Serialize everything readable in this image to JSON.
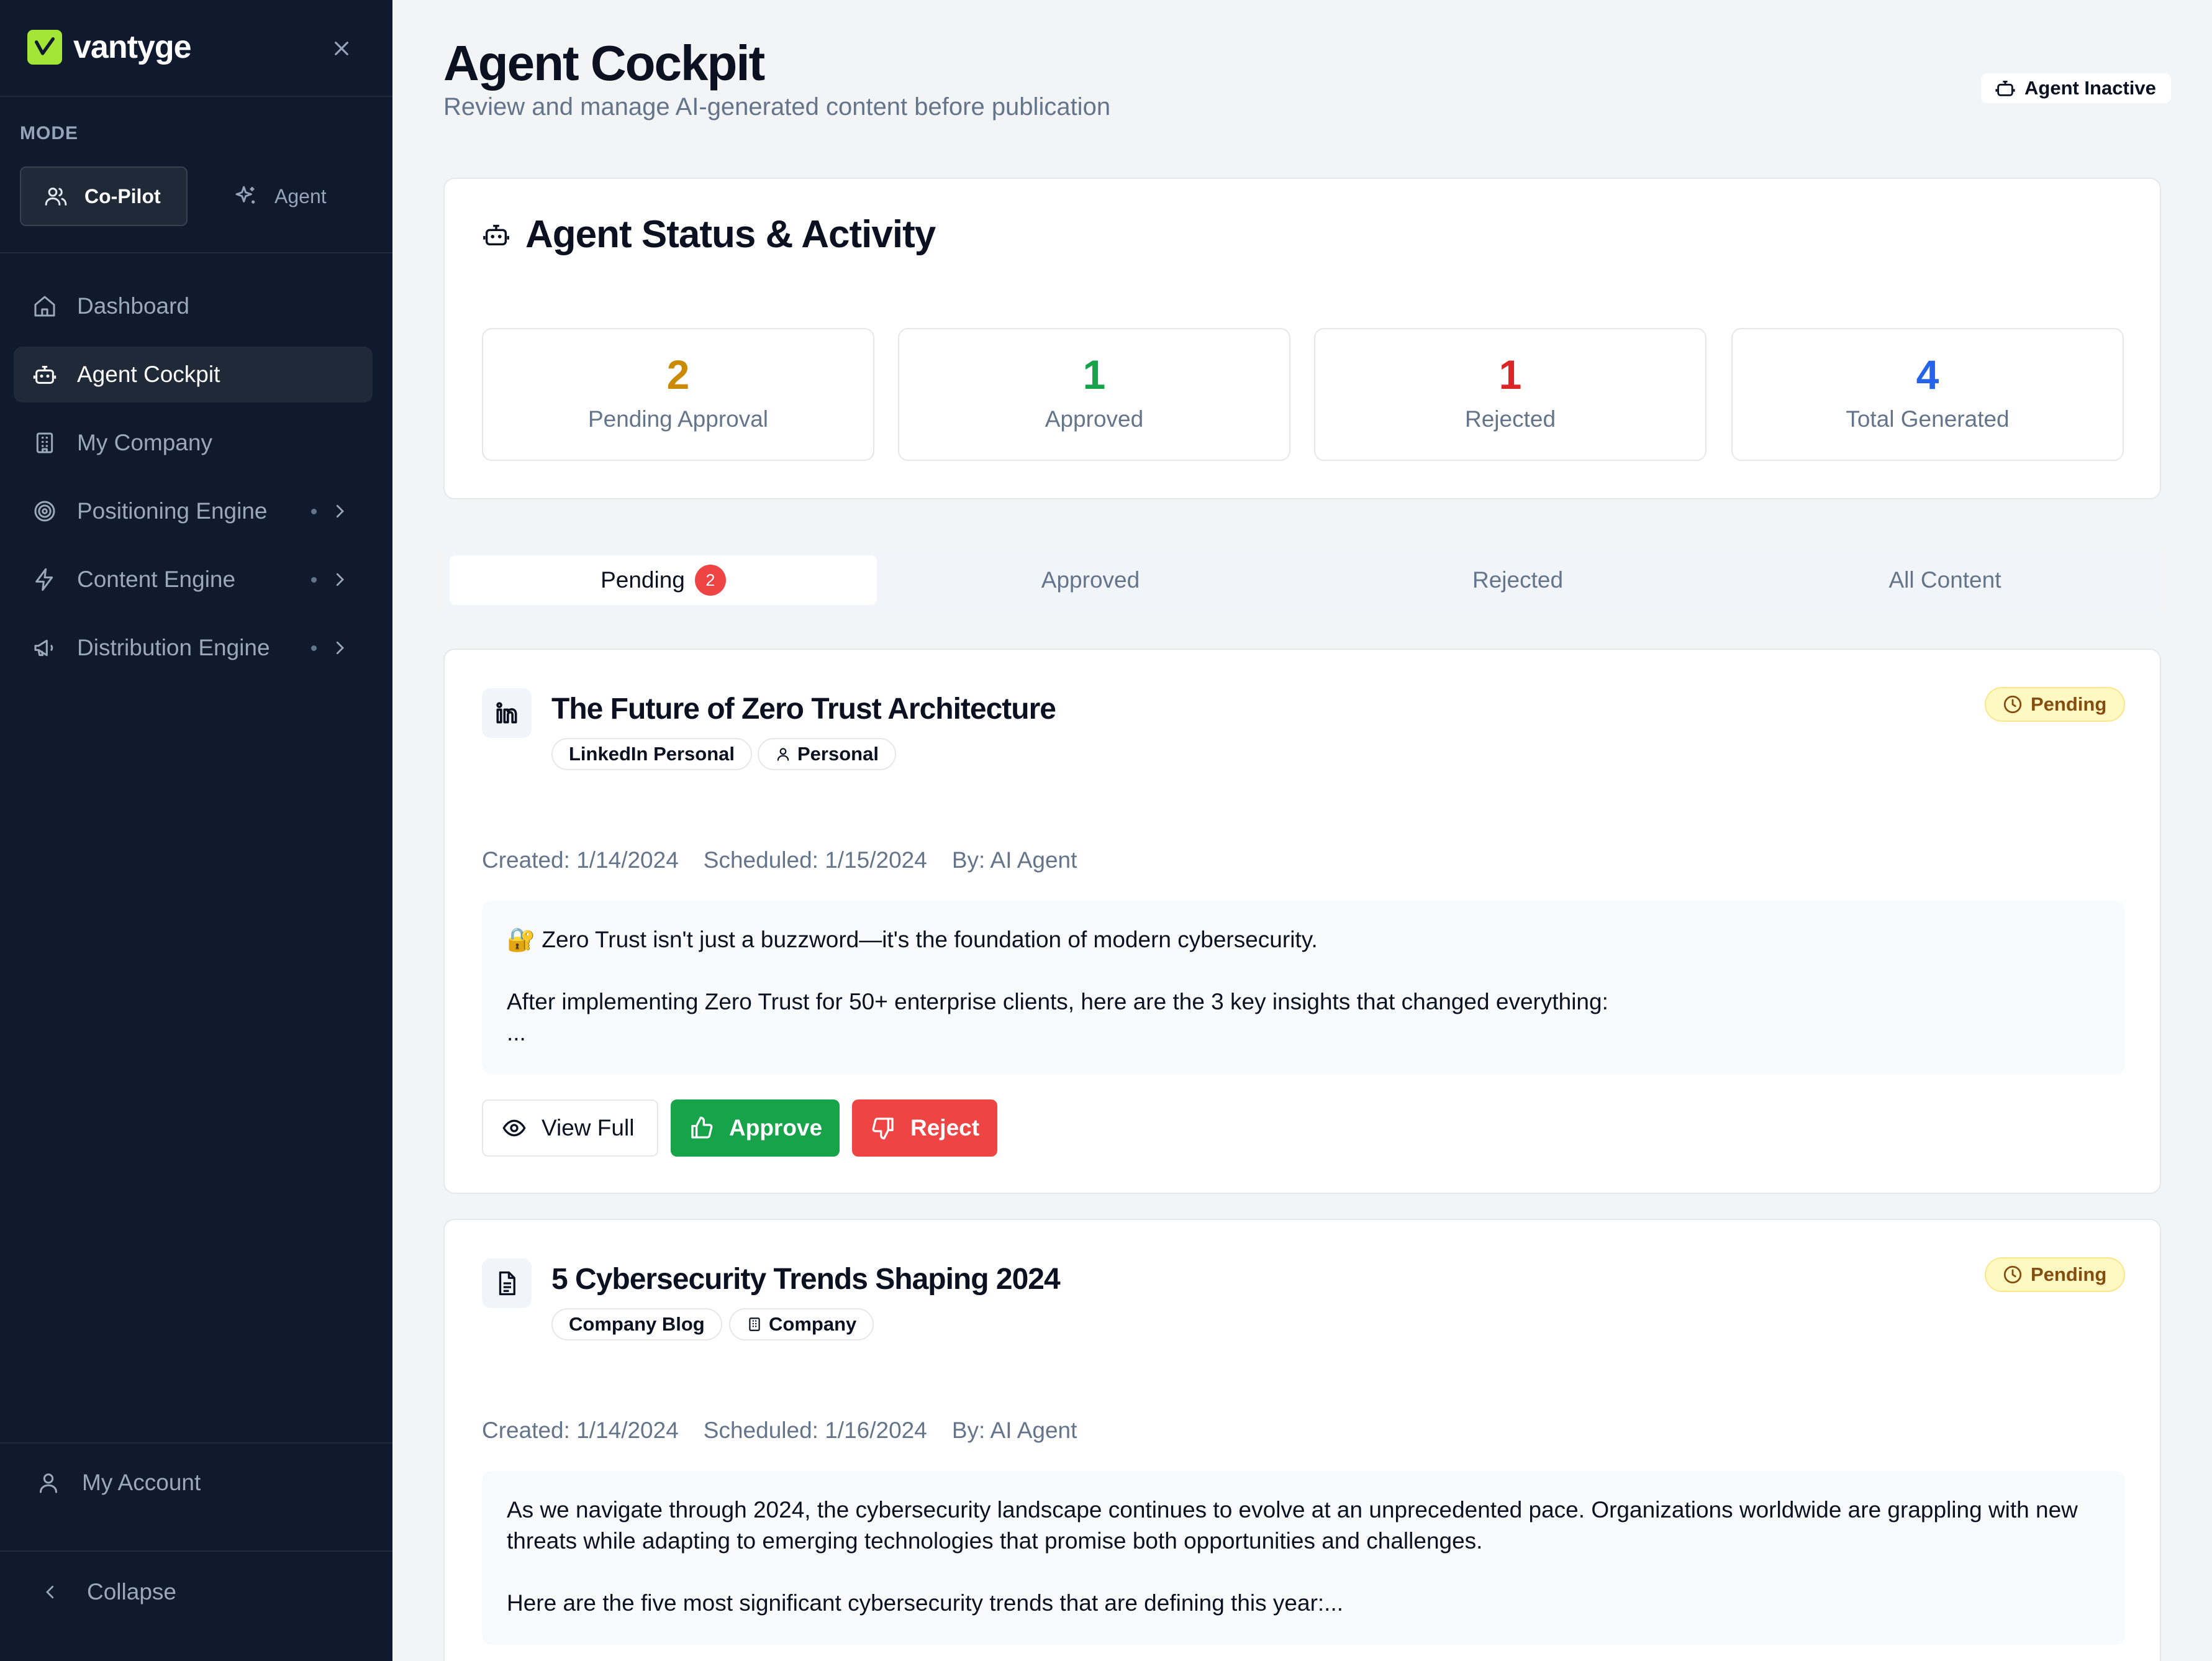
{
  "app": {
    "name": "vantyge"
  },
  "sidebar": {
    "mode_label": "MODE",
    "modes": [
      {
        "label": "Co-Pilot",
        "active": true
      },
      {
        "label": "Agent",
        "active": false
      }
    ],
    "nav": [
      {
        "label": "Dashboard",
        "icon": "home-icon",
        "active": false
      },
      {
        "label": "Agent Cockpit",
        "icon": "bot-icon",
        "active": true
      },
      {
        "label": "My Company",
        "icon": "building-icon",
        "active": false
      },
      {
        "label": "Positioning Engine",
        "icon": "target-icon",
        "active": false,
        "expandable": true
      },
      {
        "label": "Content Engine",
        "icon": "zap-icon",
        "active": false,
        "expandable": true
      },
      {
        "label": "Distribution Engine",
        "icon": "megaphone-icon",
        "active": false,
        "expandable": true
      }
    ],
    "account_label": "My Account",
    "collapse_label": "Collapse"
  },
  "header": {
    "title": "Agent Cockpit",
    "subtitle": "Review and manage AI-generated content before publication",
    "agent_status": "Agent Inactive"
  },
  "status": {
    "title": "Agent Status & Activity",
    "stats": [
      {
        "value": "2",
        "label": "Pending Approval",
        "color": "#ca8a04"
      },
      {
        "value": "1",
        "label": "Approved",
        "color": "#16a34a"
      },
      {
        "value": "1",
        "label": "Rejected",
        "color": "#dc2626"
      },
      {
        "value": "4",
        "label": "Total Generated",
        "color": "#2563eb"
      }
    ]
  },
  "tabs": [
    {
      "label": "Pending",
      "badge": "2",
      "active": true
    },
    {
      "label": "Approved",
      "active": false
    },
    {
      "label": "Rejected",
      "active": false
    },
    {
      "label": "All Content",
      "active": false
    }
  ],
  "posts": [
    {
      "icon": "linkedin-icon",
      "title": "The Future of Zero Trust Architecture",
      "channel": "LinkedIn Personal",
      "audience": "Personal",
      "status": "Pending",
      "created": "Created: 1/14/2024",
      "scheduled": "Scheduled: 1/15/2024",
      "author": "By: AI Agent",
      "excerpt": [
        "🔐 Zero Trust isn't just a buzzword—it's the foundation of modern cybersecurity.",
        "",
        "After implementing Zero Trust for 50+ enterprise clients, here are the 3 key insights that changed everything:",
        "..."
      ],
      "actions": {
        "view": "View Full",
        "approve": "Approve",
        "reject": "Reject"
      }
    },
    {
      "icon": "document-icon",
      "title": "5 Cybersecurity Trends Shaping 2024",
      "channel": "Company Blog",
      "audience": "Company",
      "status": "Pending",
      "created": "Created: 1/14/2024",
      "scheduled": "Scheduled: 1/16/2024",
      "author": "By: AI Agent",
      "excerpt": [
        "As we navigate through 2024, the cybersecurity landscape continues to evolve at an unprecedented pace. Organizations worldwide are grappling with new threats while adapting to emerging technologies that promise both opportunities and challenges.",
        "",
        "Here are the five most significant cybersecurity trends that are defining this year:..."
      ]
    }
  ],
  "colors": {
    "sidebar_bg": "#101a2e",
    "accent_green": "#16a34a",
    "danger_red": "#ef4444",
    "brand_lime": "#a3e635",
    "pending_yellow": "#fef9c3"
  }
}
